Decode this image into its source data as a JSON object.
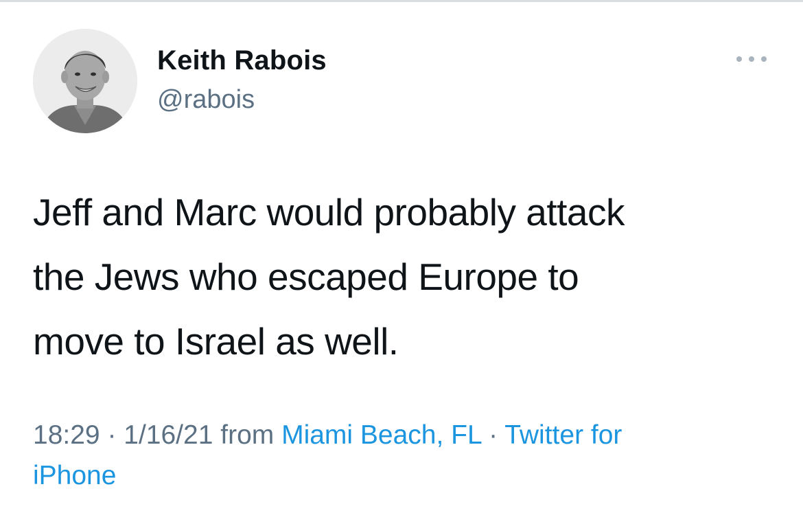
{
  "tweet": {
    "author": {
      "name": "Keith Rabois",
      "handle": "@rabois"
    },
    "text_lines": [
      "Jeff and Marc would probably attack",
      "the Jews who escaped Europe to",
      "move to Israel as well."
    ],
    "meta": {
      "time": "18:29",
      "separator": " · ",
      "date": "1/16/21",
      "from_label": " from ",
      "location": "Miami Beach, FL",
      "separator2": " · ",
      "source_part1": "Twitter for",
      "source_part2": "iPhone"
    },
    "more_icon": "more-horizontal-icon",
    "colors": {
      "text": "#0f1419",
      "secondary": "#5b7083",
      "link": "#1b95e0"
    }
  }
}
